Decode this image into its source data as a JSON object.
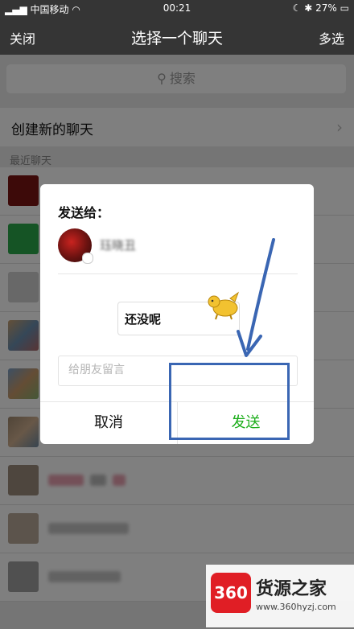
{
  "status_bar": {
    "carrier": "中国移动",
    "time": "00:21",
    "battery": "27%"
  },
  "nav": {
    "close_label": "关闭",
    "title": "选择一个聊天",
    "multi_select_label": "多选"
  },
  "search": {
    "placeholder": "搜索"
  },
  "list": {
    "create_new_chat": "创建新的聊天",
    "recent_header": "最近聊天"
  },
  "dialog": {
    "send_to_label": "发送给：",
    "recipient_name": "珏晓丑",
    "message_preview": "还没呢",
    "leave_message_placeholder": "给朋友留言",
    "cancel_label": "取消",
    "send_label": "发送"
  },
  "watermark": {
    "logo_text": "360",
    "brand": "货源之家",
    "url": "www.360hyzj.com"
  },
  "colors": {
    "nav_bg": "#353535",
    "send_green": "#1aad19",
    "annotation_blue": "#3a66b3"
  }
}
